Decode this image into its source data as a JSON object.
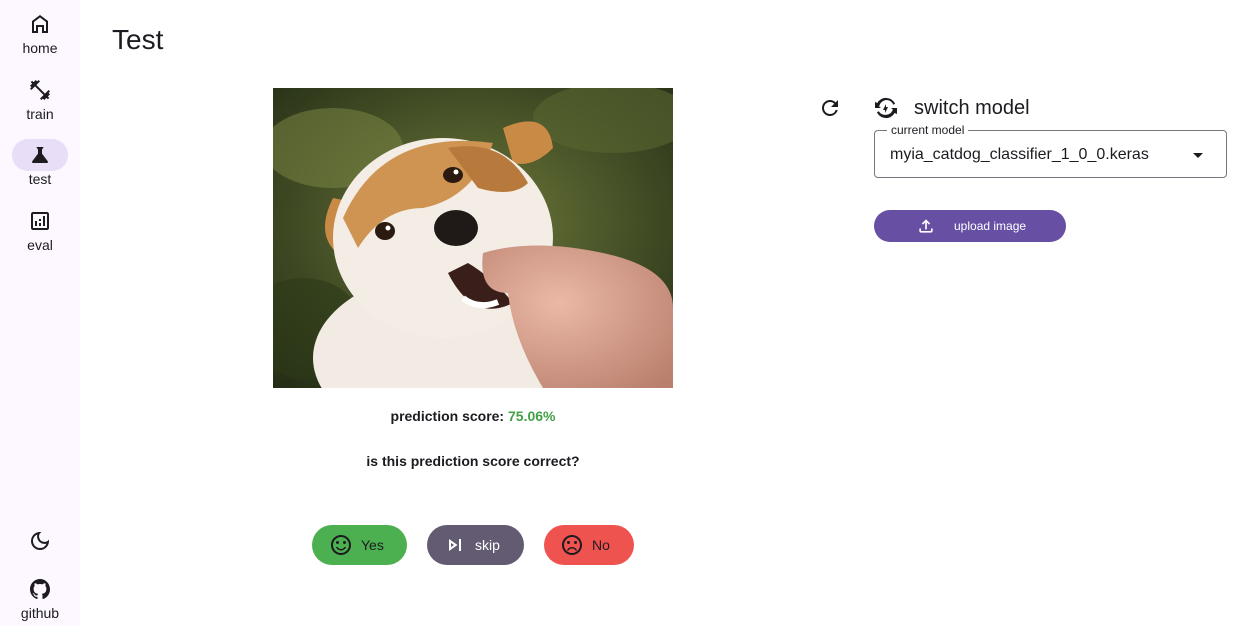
{
  "nav": {
    "items": [
      {
        "label": "home",
        "icon": "home-icon"
      },
      {
        "label": "train",
        "icon": "dumbbell-icon"
      },
      {
        "label": "test",
        "icon": "flask-icon",
        "active": true
      },
      {
        "label": "eval",
        "icon": "chart-box-icon"
      }
    ],
    "theme_icon": "moon-icon",
    "github_label": "github"
  },
  "page": {
    "title": "Test"
  },
  "prediction": {
    "image_icon": "dog-photo",
    "score_label": "prediction score:",
    "score_value": "75.06%",
    "score_color": "#43a047",
    "question": "is this prediction score correct?"
  },
  "actions": {
    "yes_label": "Yes",
    "skip_label": "skip",
    "no_label": "No",
    "yes_color": "#4caf50",
    "skip_color": "#625b71",
    "no_color": "#ef5350"
  },
  "model_panel": {
    "refresh_icon": "refresh-icon",
    "heading": "switch model",
    "field_label": "current model",
    "current_model": "myia_catdog_classifier_1_0_0.keras",
    "upload_label": "upload image",
    "accent_color": "#6750a4"
  }
}
